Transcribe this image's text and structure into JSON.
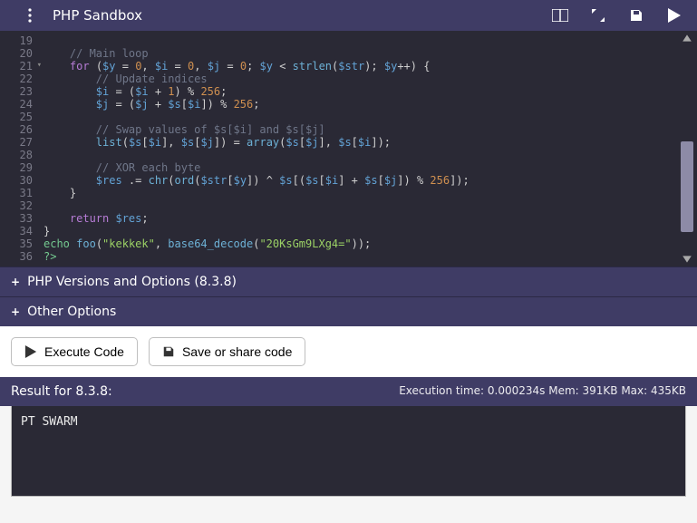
{
  "header": {
    "title": "PHP Sandbox"
  },
  "code": {
    "first_line": 19,
    "fold_lines": [
      21
    ],
    "lines": [
      {
        "seg": [
          [
            "",
            ""
          ]
        ]
      },
      {
        "seg": [
          [
            "    ",
            ""
          ],
          [
            "// Main loop",
            "cmt"
          ]
        ]
      },
      {
        "seg": [
          [
            "    ",
            ""
          ],
          [
            "for ",
            "kw"
          ],
          [
            "(",
            ""
          ],
          [
            "$y",
            "var"
          ],
          [
            " = ",
            ""
          ],
          [
            "0",
            "num"
          ],
          [
            ", ",
            ""
          ],
          [
            "$i",
            "var"
          ],
          [
            " = ",
            ""
          ],
          [
            "0",
            "num"
          ],
          [
            ", ",
            ""
          ],
          [
            "$j",
            "var"
          ],
          [
            " = ",
            ""
          ],
          [
            "0",
            "num"
          ],
          [
            "; ",
            ""
          ],
          [
            "$y",
            "var"
          ],
          [
            " < ",
            ""
          ],
          [
            "strlen",
            "fn"
          ],
          [
            "(",
            ""
          ],
          [
            "$str",
            "var"
          ],
          [
            "); ",
            ""
          ],
          [
            "$y",
            "var"
          ],
          [
            "++) {",
            ""
          ]
        ]
      },
      {
        "seg": [
          [
            "        ",
            ""
          ],
          [
            "// Update indices",
            "cmt"
          ]
        ]
      },
      {
        "seg": [
          [
            "        ",
            ""
          ],
          [
            "$i",
            "var"
          ],
          [
            " = (",
            ""
          ],
          [
            "$i",
            "var"
          ],
          [
            " + ",
            ""
          ],
          [
            "1",
            "num"
          ],
          [
            ") % ",
            ""
          ],
          [
            "256",
            "num"
          ],
          [
            ";",
            ""
          ]
        ]
      },
      {
        "seg": [
          [
            "        ",
            ""
          ],
          [
            "$j",
            "var"
          ],
          [
            " = (",
            ""
          ],
          [
            "$j",
            "var"
          ],
          [
            " + ",
            ""
          ],
          [
            "$s",
            "var"
          ],
          [
            "[",
            ""
          ],
          [
            "$i",
            "var"
          ],
          [
            "]) % ",
            ""
          ],
          [
            "256",
            "num"
          ],
          [
            ";",
            ""
          ]
        ]
      },
      {
        "seg": [
          [
            "",
            ""
          ]
        ]
      },
      {
        "seg": [
          [
            "        ",
            ""
          ],
          [
            "// Swap values of $s[$i] and $s[$j]",
            "cmt"
          ]
        ]
      },
      {
        "seg": [
          [
            "        ",
            ""
          ],
          [
            "list",
            "fn"
          ],
          [
            "(",
            ""
          ],
          [
            "$s",
            "var"
          ],
          [
            "[",
            ""
          ],
          [
            "$i",
            "var"
          ],
          [
            "], ",
            ""
          ],
          [
            "$s",
            "var"
          ],
          [
            "[",
            ""
          ],
          [
            "$j",
            "var"
          ],
          [
            "]) = ",
            ""
          ],
          [
            "array",
            "fn"
          ],
          [
            "(",
            ""
          ],
          [
            "$s",
            "var"
          ],
          [
            "[",
            ""
          ],
          [
            "$j",
            "var"
          ],
          [
            "], ",
            ""
          ],
          [
            "$s",
            "var"
          ],
          [
            "[",
            ""
          ],
          [
            "$i",
            "var"
          ],
          [
            "]);",
            ""
          ]
        ]
      },
      {
        "seg": [
          [
            "",
            ""
          ]
        ]
      },
      {
        "seg": [
          [
            "        ",
            ""
          ],
          [
            "// XOR each byte",
            "cmt"
          ]
        ]
      },
      {
        "seg": [
          [
            "        ",
            ""
          ],
          [
            "$res",
            "var"
          ],
          [
            " .= ",
            ""
          ],
          [
            "chr",
            "fn"
          ],
          [
            "(",
            ""
          ],
          [
            "ord",
            "fn"
          ],
          [
            "(",
            ""
          ],
          [
            "$str",
            "var"
          ],
          [
            "[",
            ""
          ],
          [
            "$y",
            "var"
          ],
          [
            "]) ^ ",
            ""
          ],
          [
            "$s",
            "var"
          ],
          [
            "[(",
            ""
          ],
          [
            "$s",
            "var"
          ],
          [
            "[",
            ""
          ],
          [
            "$i",
            "var"
          ],
          [
            "] + ",
            ""
          ],
          [
            "$s",
            "var"
          ],
          [
            "[",
            ""
          ],
          [
            "$j",
            "var"
          ],
          [
            "]) % ",
            ""
          ],
          [
            "256",
            "num"
          ],
          [
            "]);",
            ""
          ]
        ]
      },
      {
        "seg": [
          [
            "    }",
            ""
          ]
        ]
      },
      {
        "seg": [
          [
            "",
            ""
          ]
        ]
      },
      {
        "seg": [
          [
            "    ",
            ""
          ],
          [
            "return ",
            "kw"
          ],
          [
            "$res",
            "var"
          ],
          [
            ";",
            ""
          ]
        ]
      },
      {
        "seg": [
          [
            "}",
            ""
          ]
        ]
      },
      {
        "seg": [
          [
            "echo ",
            "grn"
          ],
          [
            "foo",
            "fn"
          ],
          [
            "(",
            ""
          ],
          [
            "\"kekkek\"",
            "str"
          ],
          [
            ", ",
            ""
          ],
          [
            "base64_decode",
            "fn"
          ],
          [
            "(",
            ""
          ],
          [
            "\"20KsGm9LXg4=\"",
            "str"
          ],
          [
            "));",
            ""
          ]
        ]
      },
      {
        "seg": [
          [
            "?>",
            "grn"
          ]
        ]
      }
    ]
  },
  "panels": {
    "versions": "PHP Versions and Options (8.3.8)",
    "other": "Other Options"
  },
  "buttons": {
    "execute": "Execute Code",
    "save": "Save or share code"
  },
  "result": {
    "title": "Result for 8.3.8:",
    "stats": "Execution time: 0.000234s Mem: 391KB Max: 435KB",
    "output": "PT SWARM"
  }
}
